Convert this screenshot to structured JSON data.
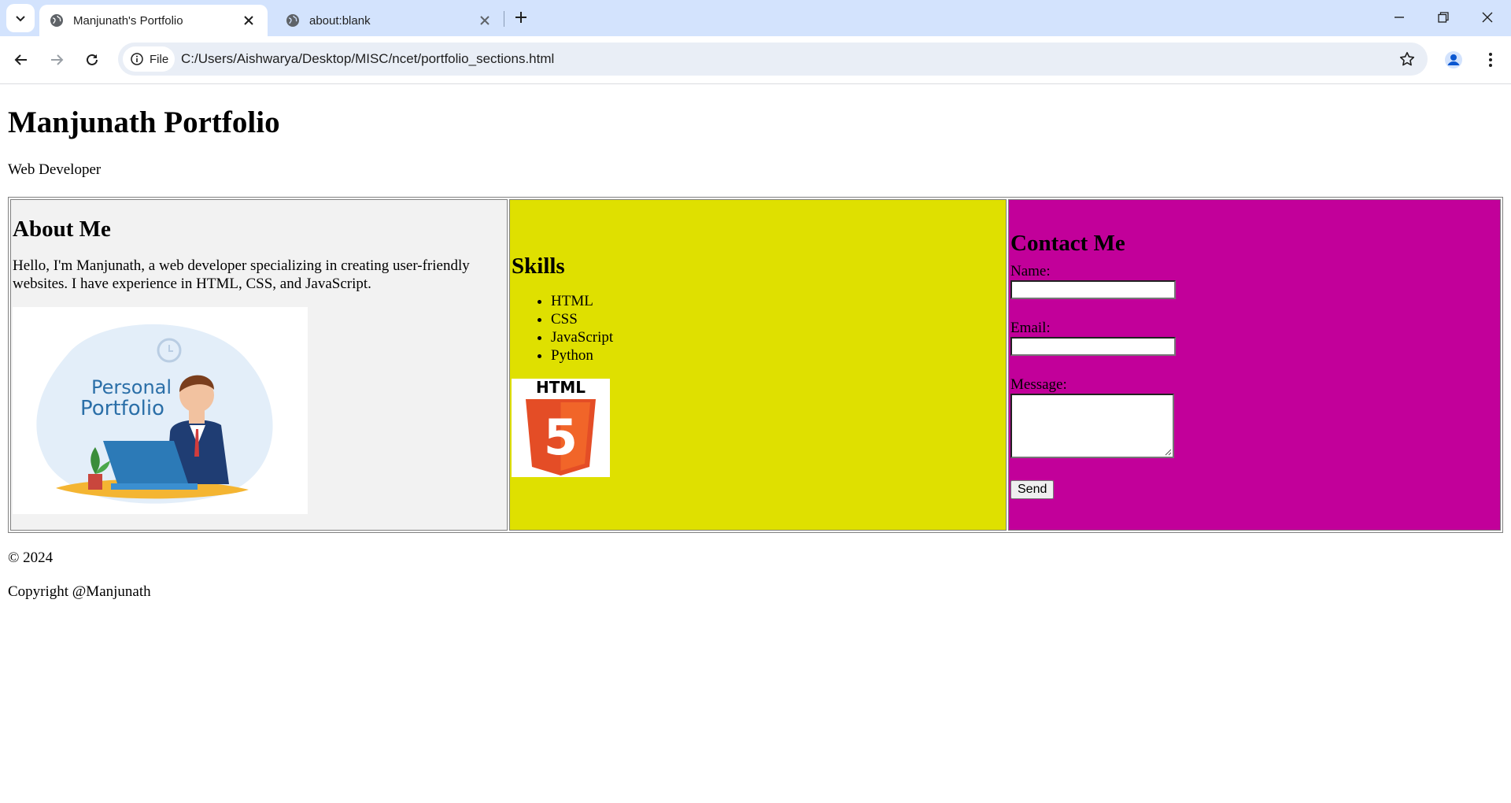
{
  "browser": {
    "tabs": [
      {
        "title": "Manjunath's Portfolio",
        "active": true
      },
      {
        "title": "about:blank",
        "active": false
      }
    ],
    "omnibox": {
      "chip_label": "File",
      "url": "C:/Users/Aishwarya/Desktop/MISC/ncet/portfolio_sections.html"
    }
  },
  "page": {
    "title": "Manjunath Portfolio",
    "subtitle": "Web Developer",
    "about": {
      "heading": "About Me",
      "text": "Hello, I'm Manjunath, a web developer specializing in creating user-friendly websites. I have experience in HTML, CSS, and JavaScript.",
      "image_text_line1": "Personal",
      "image_text_line2": "Portfolio"
    },
    "skills": {
      "heading": "Skills",
      "items": [
        "HTML",
        "CSS",
        "JavaScript",
        "Python"
      ],
      "logo_text": "HTML",
      "logo_digit": "5"
    },
    "contact": {
      "heading": "Contact Me",
      "name_label": "Name:",
      "email_label": "Email:",
      "message_label": "Message:",
      "name_value": "",
      "email_value": "",
      "message_value": "",
      "send_label": "Send"
    },
    "footer": {
      "year": "© 2024",
      "copyright": "Copyright @Manjunath"
    }
  },
  "colors": {
    "about_bg": "#f2f2f2",
    "skills_bg": "#dfe000",
    "contact_bg": "#c2009a",
    "tabstrip_bg": "#d3e3fd"
  }
}
